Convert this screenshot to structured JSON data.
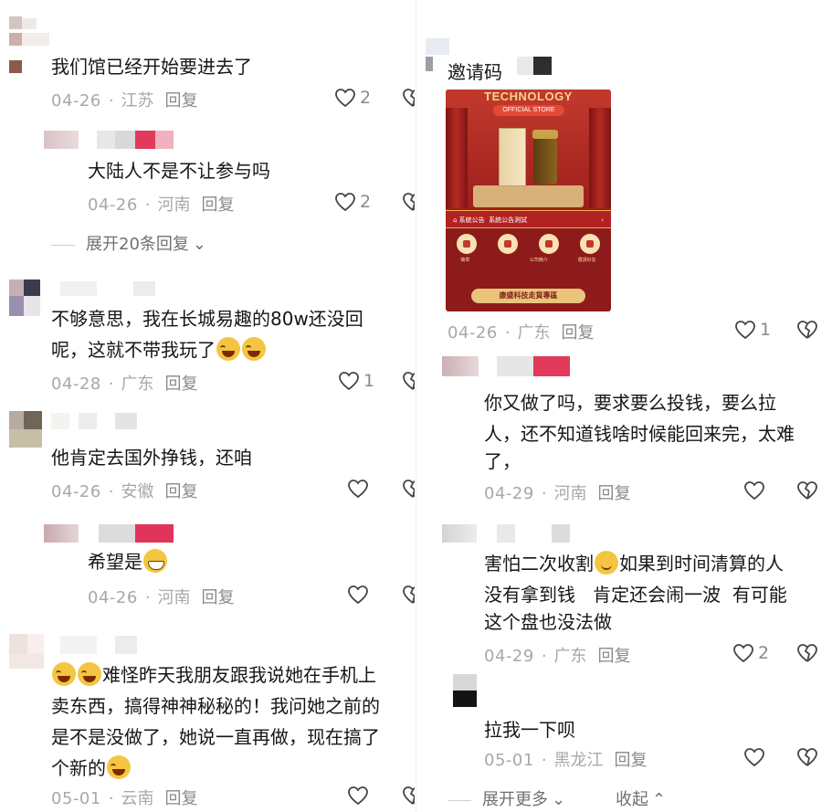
{
  "left": {
    "comments": [
      {
        "text": "我们馆已经开始要进去了",
        "date": "04-26",
        "location": "江苏",
        "reply": "回复",
        "likes": "2"
      },
      {
        "text": "大陆人不是不让参与吗",
        "date": "04-26",
        "location": "河南",
        "reply": "回复",
        "likes": "2"
      },
      {
        "text_a": "不够意思，我在长城易趣的80w还没回",
        "text_b": "呢，这就不带我玩了",
        "date": "04-28",
        "location": "广东",
        "reply": "回复",
        "likes": "1"
      },
      {
        "text": "他肯定去国外挣钱，还咱",
        "date": "04-26",
        "location": "安徽",
        "reply": "回复"
      },
      {
        "text": "希望是",
        "date": "04-26",
        "location": "河南",
        "reply": "回复"
      },
      {
        "text_a": "难怪昨天我朋友跟我说她在手机上",
        "text_b": "卖东西，搞得神神秘秘的！我问她之前的",
        "text_c": "是不是没做了，她说一直再做，现在搞了",
        "text_d": "个新的",
        "date": "05-01",
        "location": "云南",
        "reply": "回复"
      }
    ],
    "expand": "展开20条回复"
  },
  "right": {
    "comments": [
      {
        "text": "邀请码",
        "date": "04-26",
        "location": "广东",
        "reply": "回复",
        "likes": "1"
      },
      {
        "text_a": "你又做了吗，要求要么投钱，要么拉",
        "text_b": "人，还不知道钱啥时候能回来完，太难",
        "text_c": "了，",
        "date": "04-29",
        "location": "河南",
        "reply": "回复"
      },
      {
        "text_a": "害怕二次收割",
        "text_a2": "如果到时间清算的人",
        "text_b": "没有拿到钱   肯定还会闹一波  有可能",
        "text_c": "这个盘也没法做",
        "date": "04-29",
        "location": "广东",
        "reply": "回复",
        "likes": "2"
      },
      {
        "text": "拉我一下呗",
        "date": "05-01",
        "location": "黑龙江",
        "reply": "回复"
      }
    ],
    "expand_more": "展开更多",
    "collapse": "收起"
  },
  "promo": {
    "brand": "TECHNOLOGY",
    "store_badge": "OFFICIAL STORE",
    "notice_title": "系統公告",
    "notice_text": "系統公告測試",
    "icon_labels": [
      "簡章",
      "",
      "公司簡介",
      "邀請好友"
    ],
    "button": "康盛科技走貨專區"
  },
  "meta": {
    "separator": "·"
  },
  "colors": {
    "like_stroke": "#444444",
    "muted": "#a8a8a8",
    "accent_red": "#b22222"
  }
}
